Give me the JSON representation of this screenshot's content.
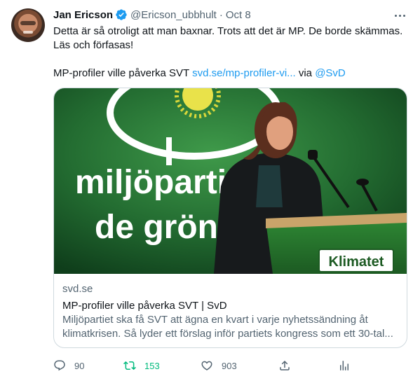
{
  "tweet": {
    "author_name": "Jan Ericson",
    "handle": "@Ericson_ubbhult",
    "separator": "·",
    "date": "Oct 8",
    "text_line1": "Detta är så otroligt att man baxnar. Trots att det är MP. De borde skämmas.",
    "text_line2": "Läs och förfasas!",
    "share_prefix": "MP-profiler ville påverka SVT ",
    "share_link": "svd.se/mp-profiler-vi...",
    "share_via": " via ",
    "share_mention": "@SvD"
  },
  "card": {
    "domain": "svd.se",
    "title": "MP-profiler ville påverka SVT | SvD",
    "description": "Miljöpartiet ska få SVT att ägna en kvart i varje nyhetssändning åt klimatkrisen. Så lyder ett förslag inför partiets kongress som ett 30-tal...",
    "image_banner_line1": "miljöparti",
    "image_banner_line2": "de grön",
    "image_sign": "Klimatet"
  },
  "actions": {
    "replies": "90",
    "retweets": "153",
    "likes": "903"
  },
  "colors": {
    "accent": "#1d9bf0",
    "retweet": "#00ba7c",
    "muted": "#536471",
    "banner_green": "#2e7d32"
  },
  "icons": [
    "verified-badge-icon",
    "more-icon",
    "reply-icon",
    "retweet-icon",
    "like-icon",
    "share-icon",
    "analytics-icon"
  ]
}
